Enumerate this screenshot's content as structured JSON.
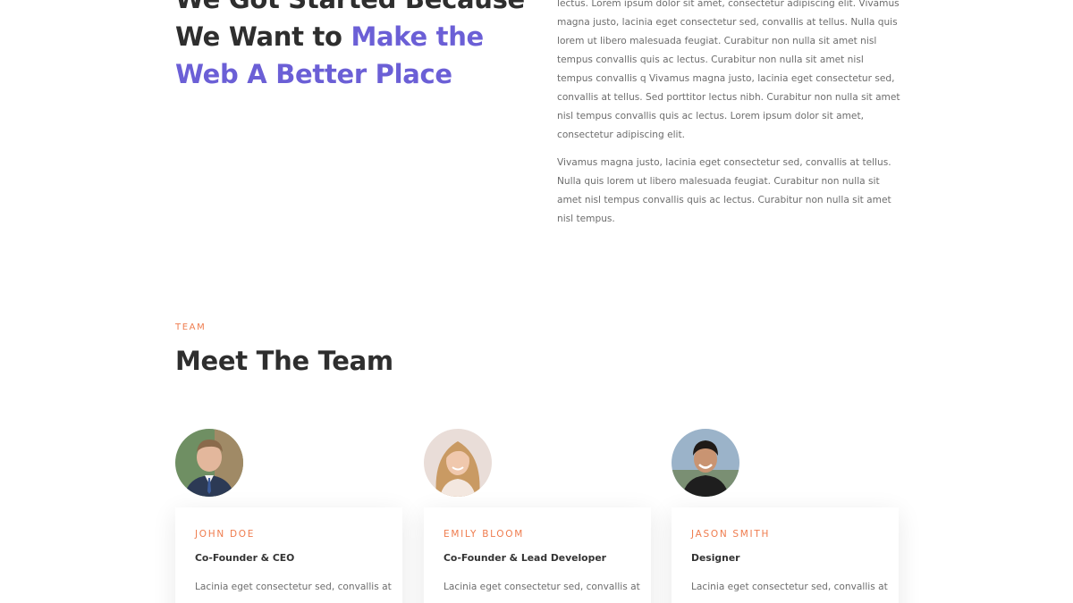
{
  "about": {
    "heading_line1": "We Got Started Because",
    "heading_line2_plain": "We Want to ",
    "heading_line2_accent": "Make the",
    "heading_line3_accent": "Web A Better Place",
    "paragraph1": "lectus. Lorem ipsum dolor sit amet, consectetur adipiscing elit. Vivamus magna justo, lacinia eget consectetur sed, convallis at tellus. Nulla quis lorem ut libero malesuada feugiat. Curabitur non nulla sit amet nisl tempus convallis quis ac lectus. Curabitur non nulla sit amet nisl tempus convallis q Vivamus magna justo, lacinia eget consectetur sed, convallis at tellus. Sed porttitor lectus nibh. Curabitur non nulla sit amet nisl tempus convallis quis ac lectus. Lorem ipsum dolor sit amet, consectetur adipiscing elit.",
    "paragraph2": "Vivamus magna justo, lacinia eget consectetur sed, convallis at tellus. Nulla quis lorem ut libero malesuada feugiat. Curabitur non nulla sit amet nisl tempus convallis quis ac lectus. Curabitur non nulla sit amet nisl tempus."
  },
  "team": {
    "eyebrow": "TEAM",
    "title": "Meet The Team",
    "members": [
      {
        "name": "JOHN DOE",
        "role": "Co-Founder & CEO",
        "bio": "Lacinia eget consectetur sed, convallis at"
      },
      {
        "name": "EMILY BLOOM",
        "role": "Co-Founder & Lead Developer",
        "bio": "Lacinia eget consectetur sed, convallis at"
      },
      {
        "name": "JASON SMITH",
        "role": "Designer",
        "bio": "Lacinia eget consectetur sed, convallis at"
      }
    ]
  },
  "colors": {
    "accent_purple": "#6b5fd6",
    "accent_orange": "#ef7c4e",
    "heading": "#2e2e2e",
    "body_text": "#6d6d6d"
  },
  "icons": [
    "avatar-john-doe",
    "avatar-emily-bloom",
    "avatar-jason-smith"
  ]
}
